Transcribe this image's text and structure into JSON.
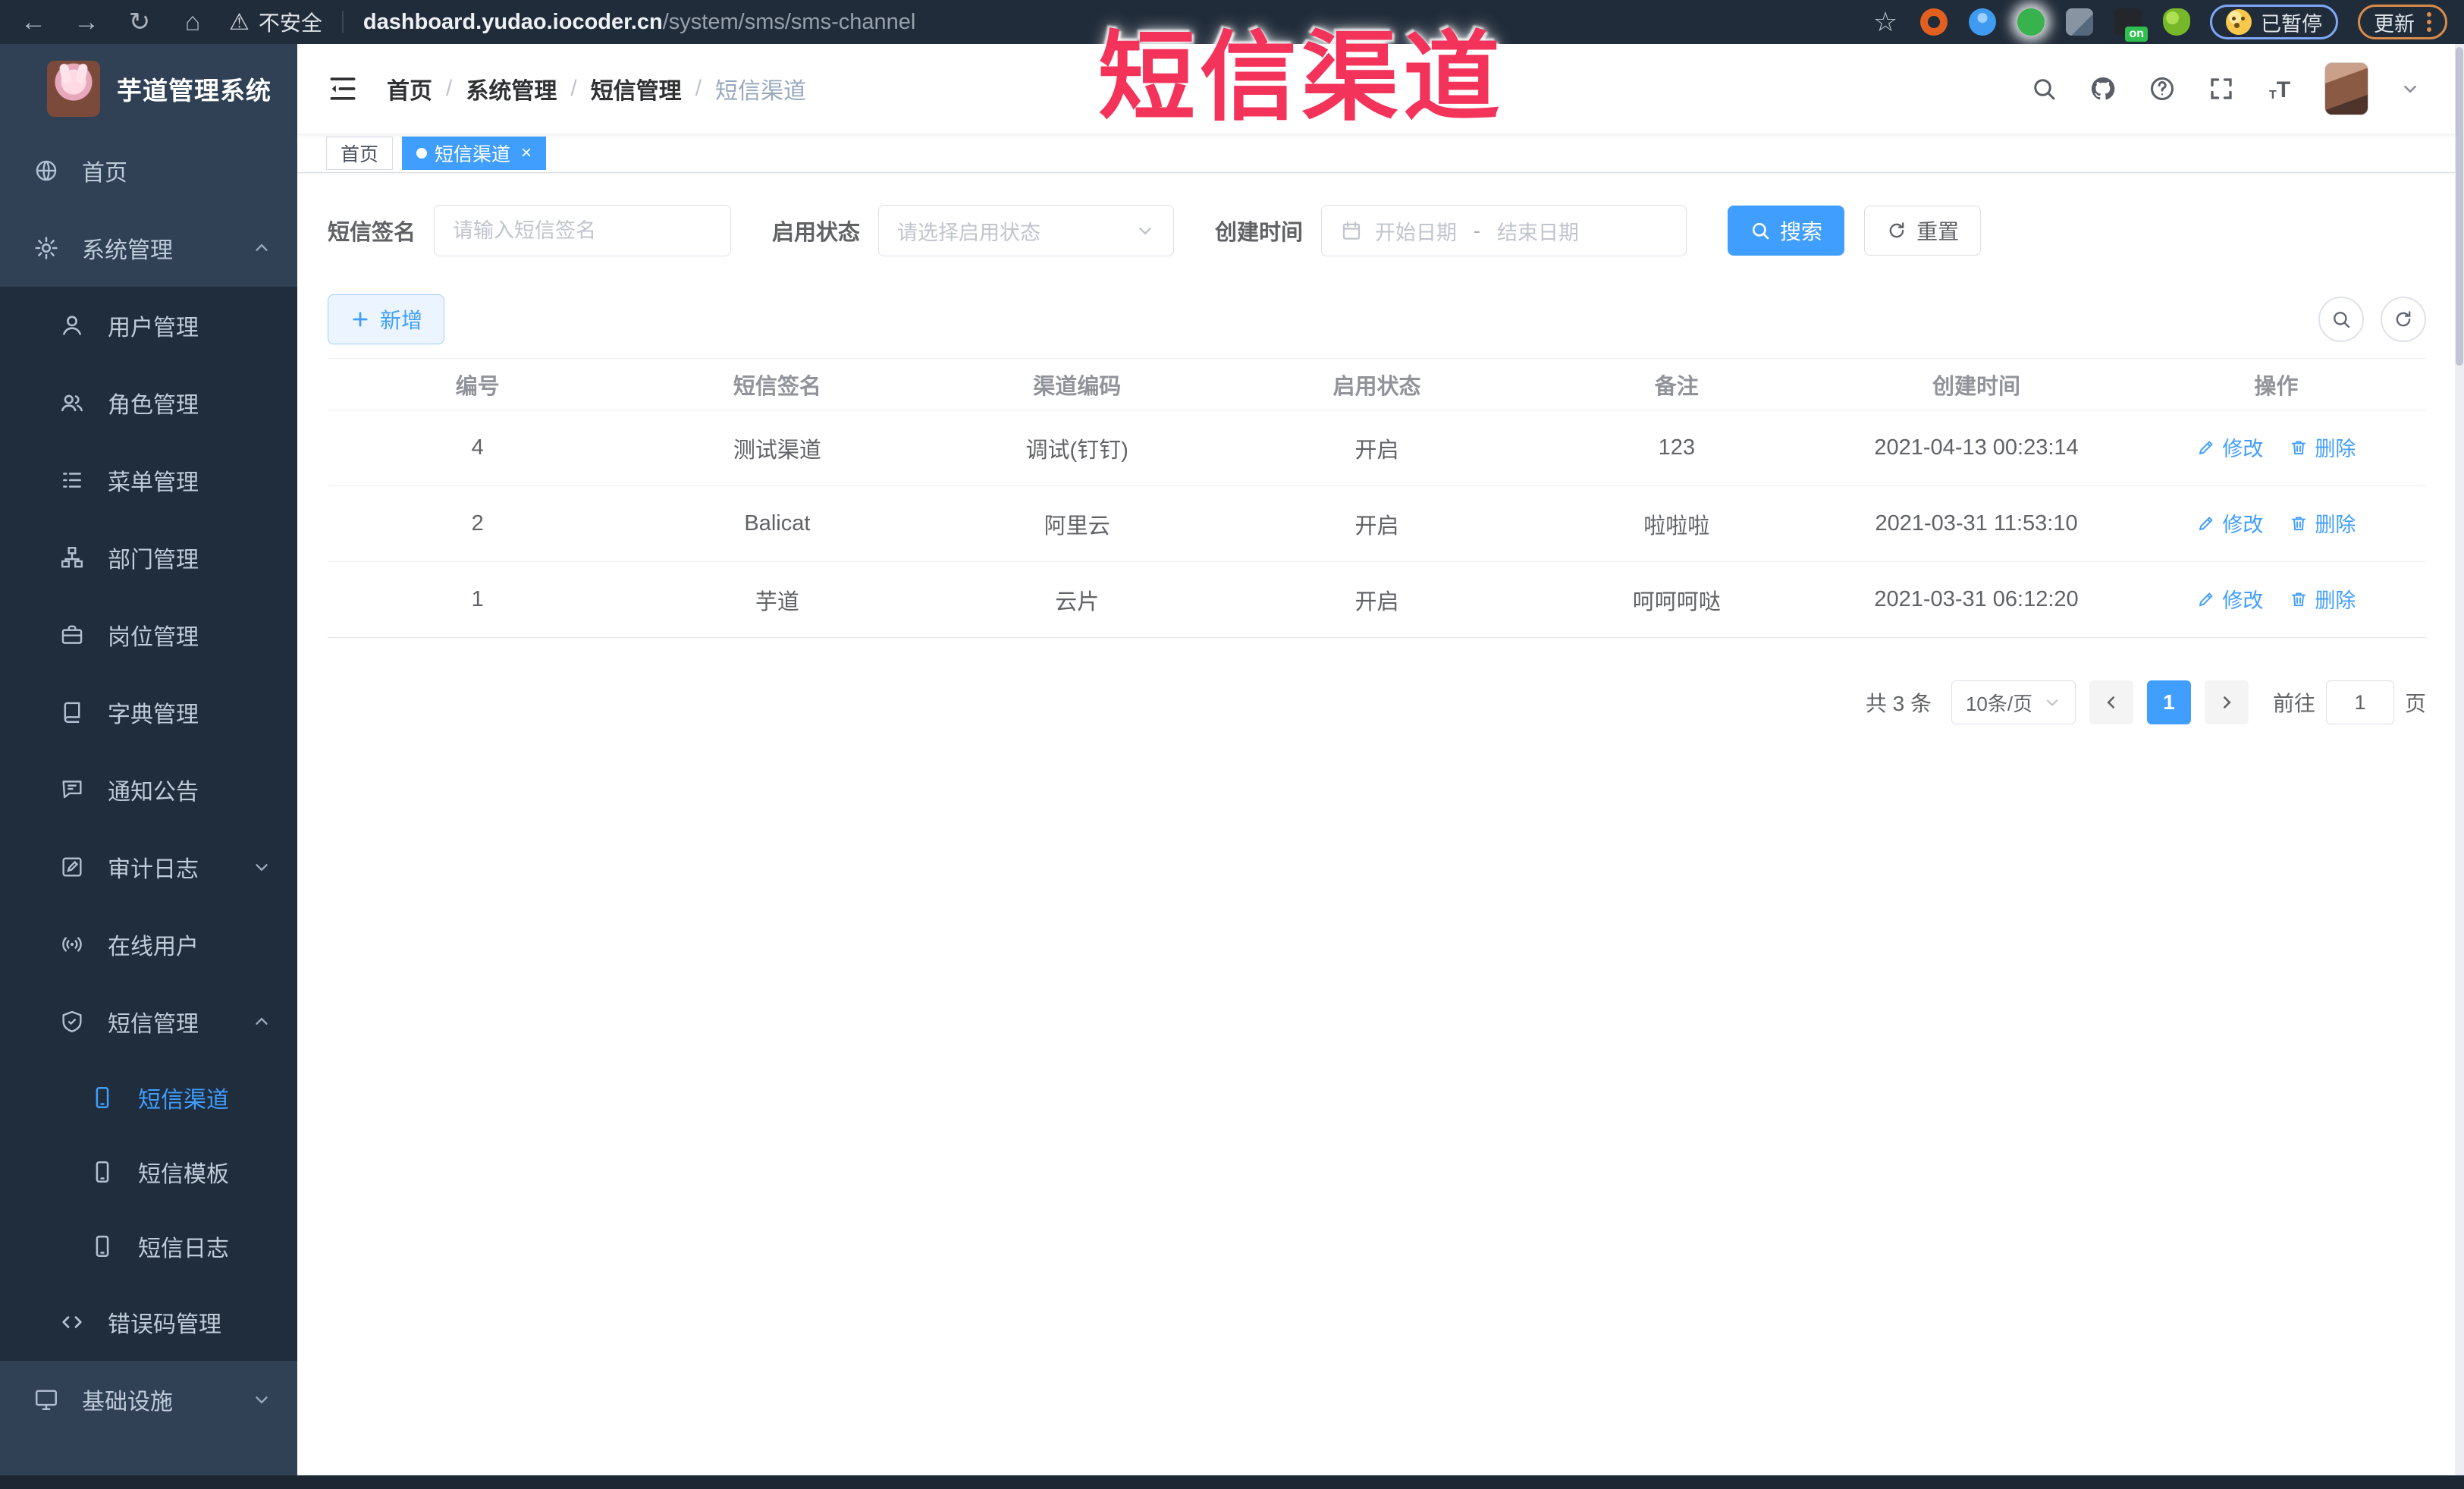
{
  "browser": {
    "security_label": "不安全",
    "url_domain": "dashboard.yudao.iocoder.cn",
    "url_path": "/system/sms/sms-channel",
    "paused_chip_label": "已暂停",
    "update_button_label": "更新",
    "extension_on_badge": "on"
  },
  "overlay": {
    "title": "短信渠道"
  },
  "sidebar": {
    "app_title": "芋道管理系统",
    "items": [
      {
        "name": "home",
        "icon": "globe",
        "label": "首页",
        "level": 1,
        "group": "top"
      },
      {
        "name": "system-mgmt",
        "icon": "gear",
        "label": "系统管理",
        "level": 1,
        "chevron": "up",
        "group": "top"
      },
      {
        "name": "user-mgmt",
        "icon": "user",
        "label": "用户管理",
        "level": 2,
        "group": "sub"
      },
      {
        "name": "role-mgmt",
        "icon": "users",
        "label": "角色管理",
        "level": 2,
        "group": "sub"
      },
      {
        "name": "menu-mgmt",
        "icon": "list",
        "label": "菜单管理",
        "level": 2,
        "group": "sub"
      },
      {
        "name": "dept-mgmt",
        "icon": "tree",
        "label": "部门管理",
        "level": 2,
        "group": "sub"
      },
      {
        "name": "post-mgmt",
        "icon": "briefcase",
        "label": "岗位管理",
        "level": 2,
        "group": "sub"
      },
      {
        "name": "dict-mgmt",
        "icon": "book",
        "label": "字典管理",
        "level": 2,
        "group": "sub"
      },
      {
        "name": "notice-mgmt",
        "icon": "chat",
        "label": "通知公告",
        "level": 2,
        "group": "sub"
      },
      {
        "name": "audit-log",
        "icon": "log",
        "label": "审计日志",
        "level": 2,
        "chevron": "down",
        "group": "sub"
      },
      {
        "name": "online-users",
        "icon": "online",
        "label": "在线用户",
        "level": 2,
        "group": "sub"
      },
      {
        "name": "sms-mgmt",
        "icon": "shield",
        "label": "短信管理",
        "level": 2,
        "chevron": "up",
        "group": "sub"
      },
      {
        "name": "sms-channel",
        "icon": "phone",
        "label": "短信渠道",
        "level": 3,
        "active": true,
        "group": "sub"
      },
      {
        "name": "sms-template",
        "icon": "phone",
        "label": "短信模板",
        "level": 3,
        "group": "sub"
      },
      {
        "name": "sms-log",
        "icon": "phone",
        "label": "短信日志",
        "level": 3,
        "group": "sub"
      },
      {
        "name": "error-code-mgmt",
        "icon": "code",
        "label": "错误码管理",
        "level": 2,
        "group": "sub"
      },
      {
        "name": "infrastructure",
        "icon": "monitor",
        "label": "基础设施",
        "level": 1,
        "chevron": "down",
        "group": "bottom"
      }
    ]
  },
  "header": {
    "breadcrumb": [
      "首页",
      "系统管理",
      "短信管理",
      "短信渠道"
    ],
    "separator": "/"
  },
  "tabs": [
    {
      "label": "首页",
      "active": false
    },
    {
      "label": "短信渠道",
      "active": true,
      "close": "×"
    }
  ],
  "filters": {
    "sign_label": "短信签名",
    "sign_placeholder": "请输入短信签名",
    "status_label": "启用状态",
    "status_placeholder": "请选择启用状态",
    "time_label": "创建时间",
    "start_placeholder": "开始日期",
    "range_separator": "-",
    "end_placeholder": "结束日期",
    "search_label": "搜索",
    "reset_label": "重置"
  },
  "toolbar": {
    "add_label": "新增"
  },
  "table": {
    "columns": [
      "编号",
      "短信签名",
      "渠道编码",
      "启用状态",
      "备注",
      "创建时间",
      "操作"
    ],
    "rows": [
      {
        "id": "4",
        "sign": "测试渠道",
        "code": "调试(钉钉)",
        "status": "开启",
        "remark": "123",
        "created": "2021-04-13 00:23:14"
      },
      {
        "id": "2",
        "sign": "Balicat",
        "code": "阿里云",
        "status": "开启",
        "remark": "啦啦啦",
        "created": "2021-03-31 11:53:10"
      },
      {
        "id": "1",
        "sign": "芋道",
        "code": "云片",
        "status": "开启",
        "remark": "呵呵呵哒",
        "created": "2021-03-31 06:12:20"
      }
    ],
    "edit_label": "修改",
    "delete_label": "删除"
  },
  "pagination": {
    "total_label": "共 3 条",
    "page_size_label": "10条/页",
    "current_page": "1",
    "goto_label": "前往",
    "goto_value": "1",
    "page_unit_label": "页"
  },
  "colors": {
    "accent": "#409eff",
    "annotation": "#f3335a",
    "sidebar": "#304156"
  }
}
